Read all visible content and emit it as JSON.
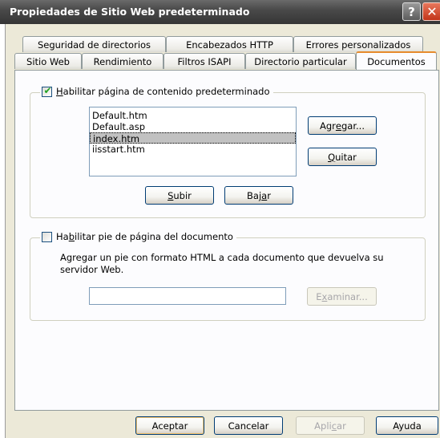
{
  "window": {
    "title": "Propiedades de Sitio Web predeterminado",
    "help_glyph": "?",
    "close_glyph": "✕"
  },
  "tabs_row1": [
    {
      "label": "Seguridad de directorios"
    },
    {
      "label": "Encabezados HTTP"
    },
    {
      "label": "Errores personalizados"
    }
  ],
  "tabs_row2": [
    {
      "label": "Sitio Web"
    },
    {
      "label": "Rendimiento"
    },
    {
      "label": "Filtros ISAPI"
    },
    {
      "label": "Directorio particular"
    },
    {
      "label": "Documentos",
      "active": true
    }
  ],
  "default_content": {
    "checked": true,
    "check_glyph": "✔",
    "label_mnemonic": "H",
    "label_rest": "abilitar página de contenido predeterminado",
    "documents": [
      "Default.htm",
      "Default.asp",
      "index.htm",
      "iisstart.htm"
    ],
    "selected_index": 2,
    "add_button": {
      "before": "Agr",
      "mnemonic": "e",
      "after": "gar..."
    },
    "remove_button": {
      "before": "",
      "mnemonic": "Q",
      "after": "uitar"
    },
    "up_button": {
      "before": "",
      "mnemonic": "S",
      "after": "ubir"
    },
    "down_button": {
      "before": "Baj",
      "mnemonic": "a",
      "after": "r"
    }
  },
  "footer_section": {
    "checked": false,
    "label_before": "Ha",
    "label_mnemonic": "b",
    "label_after": "ilitar pie de página del documento",
    "description": "Agregar un pie con formato HTML a cada documento que devuelva su servidor Web.",
    "path_value": "",
    "browse_button": {
      "before": "E",
      "mnemonic": "x",
      "after": "aminar..."
    }
  },
  "buttons": {
    "accept": "Aceptar",
    "cancel": "Cancelar",
    "apply": {
      "before": "Apli",
      "mnemonic": "c",
      "after": "ar"
    },
    "help": "Ayuda"
  }
}
